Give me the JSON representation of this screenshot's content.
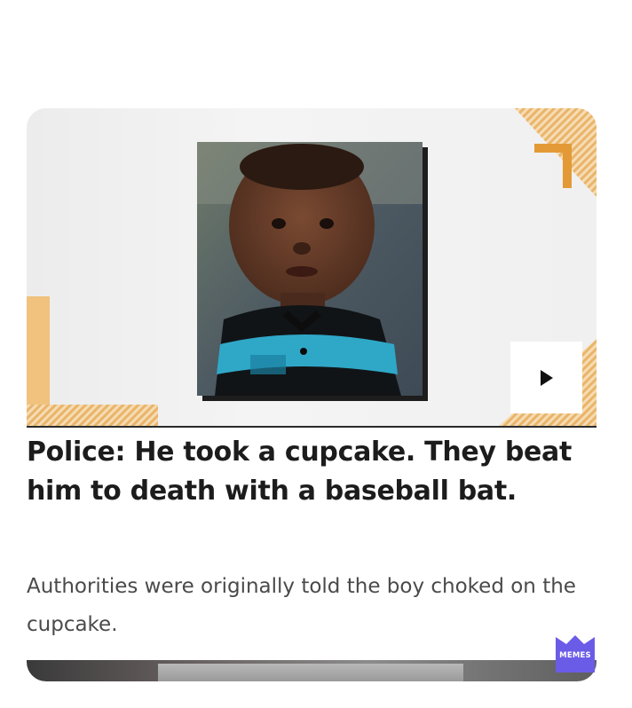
{
  "article": {
    "headline": "Police: He took a cupcake. They beat him to death with a baseball bat.",
    "summary": "Authorities were originally told the boy choked on the cupcake."
  },
  "hero": {
    "media_icon": "play-icon",
    "accent_color": "#e8a64a"
  },
  "watermark": {
    "label": "MEMES",
    "color": "#6b5ce7"
  }
}
